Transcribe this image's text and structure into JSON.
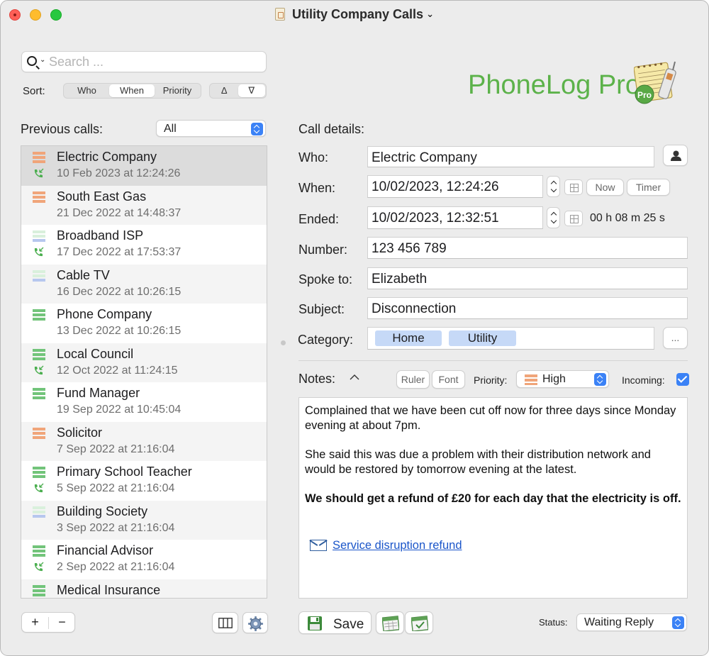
{
  "window": {
    "title": "Utility Company Calls"
  },
  "search": {
    "placeholder": "Search ..."
  },
  "sort": {
    "label": "Sort:",
    "options": [
      "Who",
      "When",
      "Priority"
    ],
    "selected": "When",
    "ascending": "Δ",
    "descending": "∇"
  },
  "brand": {
    "name": "PhoneLog Pro",
    "badge": "Pro"
  },
  "list": {
    "label": "Previous calls:",
    "filter": "All",
    "items": [
      {
        "name": "Electric Company",
        "date": "10 Feb 2023 at 12:24:26",
        "priority": "high",
        "incoming": true
      },
      {
        "name": "South East Gas",
        "date": "21 Dec 2022 at 14:48:37",
        "priority": "high",
        "incoming": false
      },
      {
        "name": "Broadband ISP",
        "date": "17 Dec 2022 at 17:53:37",
        "priority": "low",
        "incoming": true
      },
      {
        "name": "Cable TV",
        "date": "16 Dec 2022 at 10:26:15",
        "priority": "low",
        "incoming": false
      },
      {
        "name": "Phone Company",
        "date": "13 Dec 2022 at 10:26:15",
        "priority": "normal",
        "incoming": false
      },
      {
        "name": "Local Council",
        "date": "12 Oct 2022 at 11:24:15",
        "priority": "normal",
        "incoming": true
      },
      {
        "name": "Fund Manager",
        "date": "19 Sep 2022 at 10:45:04",
        "priority": "normal",
        "incoming": false
      },
      {
        "name": "Solicitor",
        "date": "7 Sep 2022 at 21:16:04",
        "priority": "high",
        "incoming": false
      },
      {
        "name": "Primary School Teacher",
        "date": "5 Sep 2022 at 21:16:04",
        "priority": "normal",
        "incoming": true
      },
      {
        "name": "Building Society",
        "date": "3 Sep 2022 at 21:16:04",
        "priority": "low",
        "incoming": false
      },
      {
        "name": "Financial Advisor",
        "date": "2 Sep 2022 at 21:16:04",
        "priority": "normal",
        "incoming": true
      },
      {
        "name": "Medical Insurance",
        "date": "",
        "priority": "normal",
        "incoming": false
      }
    ],
    "add": "+",
    "remove": "−"
  },
  "details": {
    "heading": "Call details:",
    "who_label": "Who:",
    "who": "Electric Company",
    "when_label": "When:",
    "when": "10/02/2023, 12:24:26",
    "now_button": "Now",
    "timer_button": "Timer",
    "ended_label": "Ended:",
    "ended": "10/02/2023, 12:32:51",
    "duration": "00 h 08 m 25 s",
    "number_label": "Number:",
    "number": "123 456 789",
    "spoke_label": "Spoke to:",
    "spoke": "Elizabeth",
    "subject_label": "Subject:",
    "subject": "Disconnection",
    "category_label": "Category:",
    "categories": [
      "Home",
      "Utility"
    ],
    "category_more": "..."
  },
  "notes": {
    "label": "Notes:",
    "ruler": "Ruler",
    "font": "Font",
    "priority_label": "Priority:",
    "priority": "High",
    "incoming_label": "Incoming:",
    "incoming": true,
    "para1": "Complained that we have been cut off now for three days since Monday evening at about 7pm.",
    "para2": "She said this was due a problem with their distribution network and would be restored by tomorrow evening at the latest.",
    "para3": "We should get a refund of £20 for each day that the electricity is off.",
    "link": "Service disruption refund"
  },
  "footer": {
    "save": "Save",
    "status_label": "Status:",
    "status": "Waiting Reply"
  },
  "colors": {
    "priority_high": "#f0a57a",
    "priority_normal": "#72c47a",
    "priority_low": "#b6c7ee",
    "accent": "#3b82f6",
    "brand": "#5cb24a",
    "link": "#1a55c9"
  }
}
